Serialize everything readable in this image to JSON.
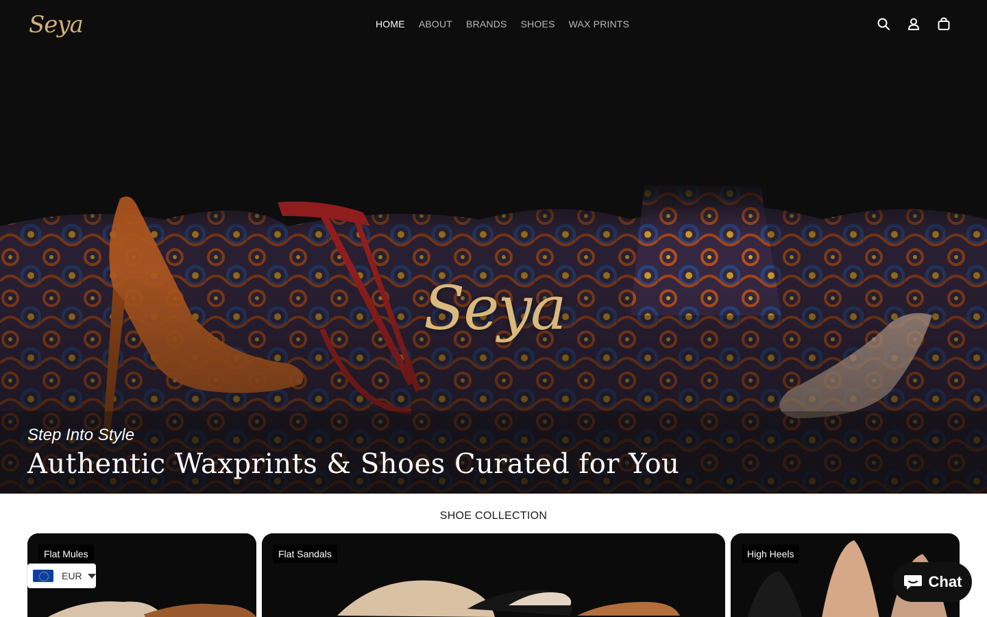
{
  "brand": {
    "logo_text": "Seya"
  },
  "nav": {
    "items": [
      {
        "label": "HOME",
        "active": true
      },
      {
        "label": "ABOUT",
        "active": false
      },
      {
        "label": "BRANDS",
        "active": false
      },
      {
        "label": "SHOES",
        "active": false
      },
      {
        "label": "WAX PRINTS",
        "active": false
      }
    ]
  },
  "header_icons": [
    "search-icon",
    "account-icon",
    "cart-icon"
  ],
  "hero": {
    "logo_text": "Seya",
    "subtitle": "Step Into Style",
    "title": "Authentic Waxprints & Shoes Curated for You"
  },
  "collection": {
    "heading": "SHOE COLLECTION",
    "cards": [
      {
        "label": "Flat Mules"
      },
      {
        "label": "Flat Sandals"
      },
      {
        "label": "High Heels"
      }
    ]
  },
  "currency": {
    "code": "EUR",
    "flag": "eu-flag-icon"
  },
  "chat": {
    "label": "Chat"
  },
  "colors": {
    "accent_gold": "#d3b07a",
    "hero_bg": "#0d0d0d",
    "text_white": "#ffffff"
  }
}
